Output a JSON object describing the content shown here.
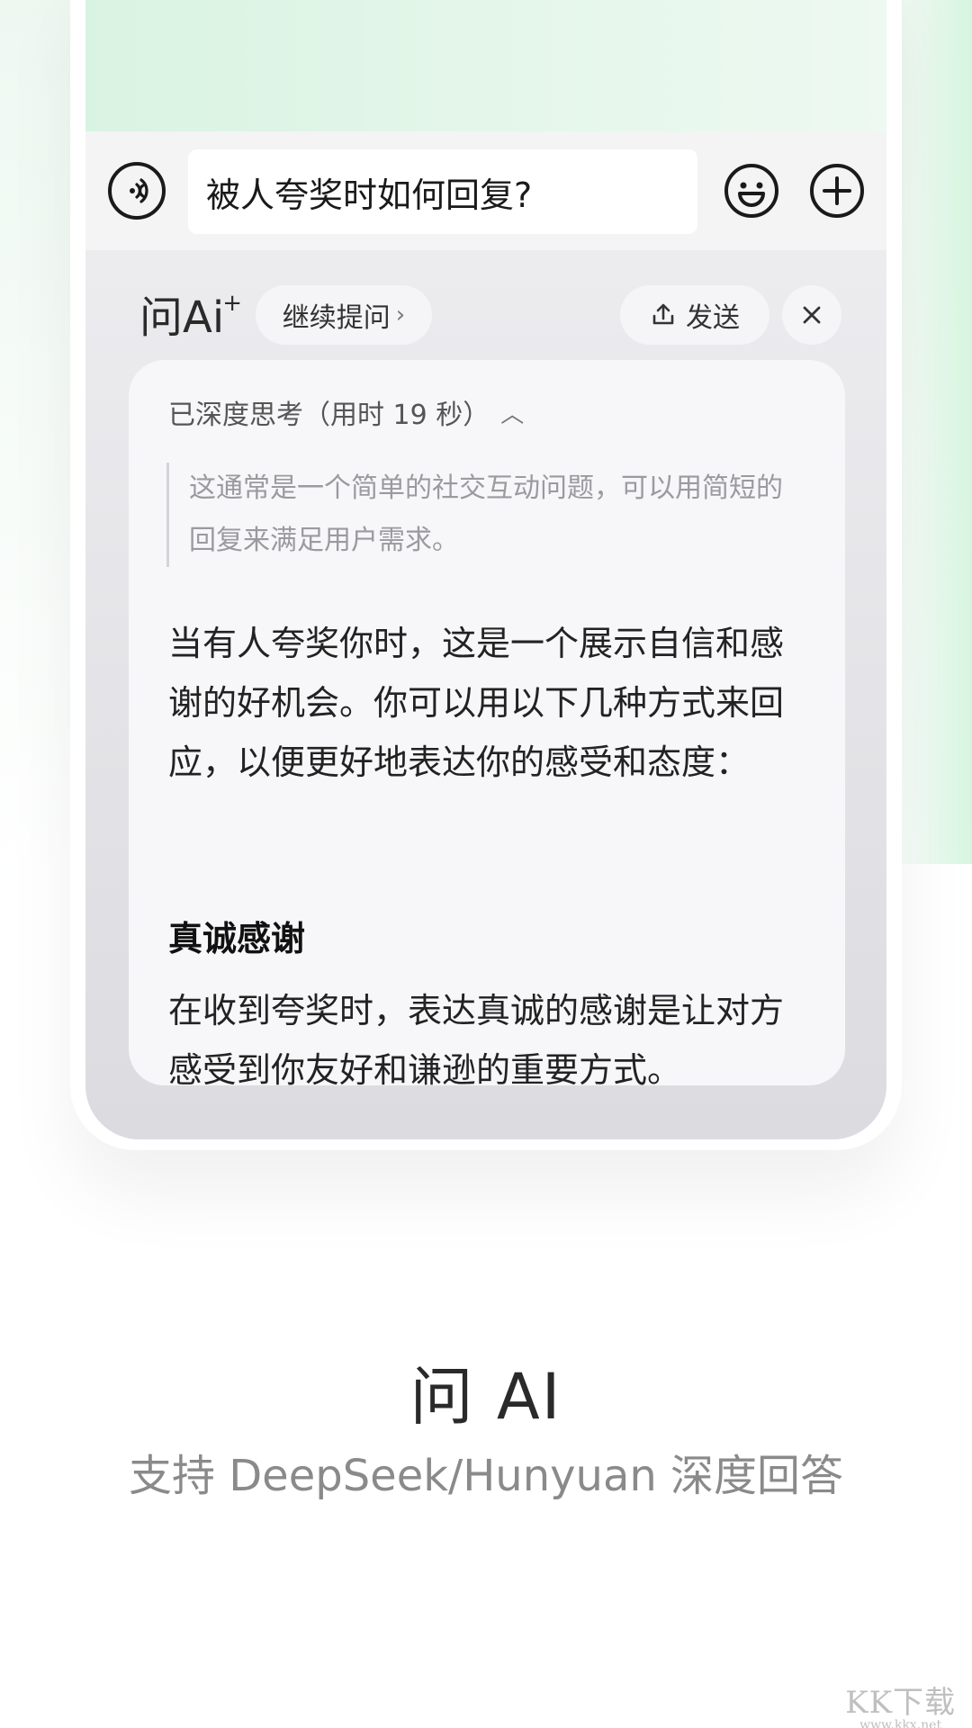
{
  "input_bar": {
    "text_value": "被人夸奖时如何回复?"
  },
  "ai_panel": {
    "logo_text": "问Ai",
    "continue_button": "继续提问",
    "send_button": "发送",
    "thinking": {
      "header": "已深度思考（用时 19 秒）",
      "content": "这通常是一个简单的社交互动问题，可以用简短的回复来满足用户需求。"
    },
    "answer": {
      "intro": "当有人夸奖你时，这是一个展示自信和感谢的好机会。你可以用以下几种方式来回应，以便更好地表达你的感受和态度：",
      "section_title": "真诚感谢",
      "section_text": "在收到夸奖时，表达真诚的感谢是让对方感受到你友好和谦逊的重要方式。"
    }
  },
  "caption": {
    "title": "问 AI",
    "subtitle": "支持 DeepSeek/Hunyuan 深度回答"
  },
  "watermark": {
    "main": "KK下载",
    "url": "www.kkx.net"
  },
  "colors": {
    "accent_green": "#e4f6ea",
    "panel_gray": "#dcdce0",
    "card_bg": "#f7f7f9"
  }
}
